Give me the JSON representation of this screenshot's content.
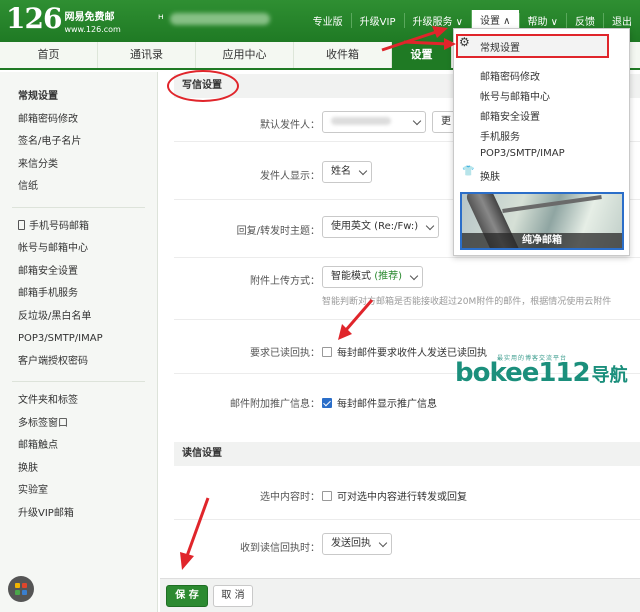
{
  "header": {
    "logo_number": "126",
    "logo_title": "网易免费邮",
    "logo_url": "www.126.com",
    "nav": [
      "专业版",
      "升级VIP",
      "升级服务 ∨",
      "设置 ∧",
      "帮助 ∨",
      "反馈",
      "退出"
    ]
  },
  "tabs": [
    "首页",
    "通讯录",
    "应用中心",
    "收件箱",
    "设置"
  ],
  "sidebar": {
    "group1": [
      "常规设置",
      "邮箱密码修改",
      "签名/电子名片",
      "来信分类",
      "信纸"
    ],
    "group2": [
      "手机号码邮箱",
      "帐号与邮箱中心",
      "邮箱安全设置",
      "邮箱手机服务",
      "反垃圾/黑白名单",
      "POP3/SMTP/IMAP",
      "客户端授权密码"
    ],
    "group3": [
      "文件夹和标签",
      "多标签窗口",
      "邮箱触点",
      "换肤",
      "实验室",
      "升级VIP邮箱"
    ]
  },
  "write_settings": {
    "title": "写信设置",
    "default_sender_label": "默认发件人：",
    "default_sender_btn": "更",
    "sender_display_label": "发件人显示：",
    "sender_display_value": "姓名",
    "reply_subject_label": "回复/转发时主题：",
    "reply_subject_value": "使用英文 (Re:/Fw:)",
    "attach_label": "附件上传方式：",
    "attach_value": "智能模式",
    "attach_tag": "(推荐)",
    "attach_hint": "智能判断对方邮箱是否能接收超过20M附件的邮件，根据情况使用云附件",
    "read_receipt_label": "要求已读回执：",
    "read_receipt_text": "每封邮件要求收件人发送已读回执",
    "promo_label": "邮件附加推广信息：",
    "promo_text": "每封邮件显示推广信息"
  },
  "read_settings": {
    "title": "读信设置",
    "select_label": "选中内容时：",
    "select_text": "可对选中内容进行转发或回复",
    "receipt_label": "收到读信回执时：",
    "receipt_value": "发送回执"
  },
  "buttons": {
    "save": "保 存",
    "cancel": "取 消"
  },
  "dropdown": {
    "items": [
      "常规设置",
      "邮箱密码修改",
      "帐号与邮箱中心",
      "邮箱安全设置",
      "手机服务",
      "POP3/SMTP/IMAP",
      "换肤"
    ],
    "skin_caption": "纯净邮箱"
  },
  "watermark": {
    "brand": "bokee112",
    "cn": "导航",
    "tagline": "最实用的博客交流平台"
  },
  "colors": {
    "brand_green": "#1f7a24",
    "annotation_red": "#e0252b",
    "link_blue": "#2b6ec9"
  }
}
